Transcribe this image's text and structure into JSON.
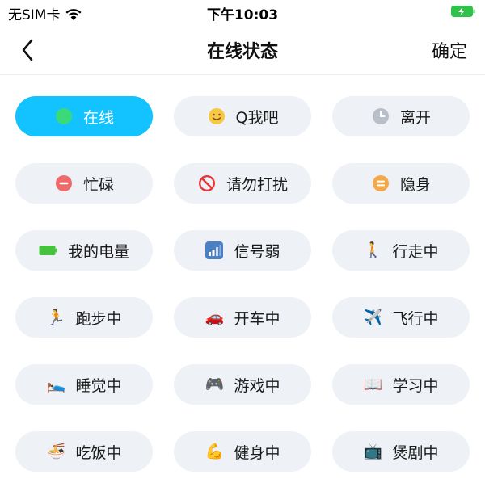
{
  "status_bar": {
    "carrier": "无SIM卡",
    "time": "下午10:03"
  },
  "nav": {
    "title": "在线状态",
    "confirm_label": "确定"
  },
  "colors": {
    "selected_bg": "#12c3ff",
    "chip_bg": "#eef1f6",
    "battery_green": "#2ec24a"
  },
  "statuses": [
    {
      "label": "在线",
      "icon": "green-dot-icon",
      "selected": true
    },
    {
      "label": "Q我吧",
      "icon": "smile-icon",
      "selected": false
    },
    {
      "label": "离开",
      "icon": "clock-icon",
      "selected": false
    },
    {
      "label": "忙碌",
      "icon": "minus-circle-icon",
      "selected": false
    },
    {
      "label": "请勿打扰",
      "icon": "no-entry-icon",
      "selected": false
    },
    {
      "label": "隐身",
      "icon": "equals-circle-icon",
      "selected": false
    },
    {
      "label": "我的电量",
      "icon": "battery-icon",
      "selected": false
    },
    {
      "label": "信号弱",
      "icon": "signal-icon",
      "selected": false
    },
    {
      "label": "行走中",
      "icon": "walking-icon",
      "selected": false
    },
    {
      "label": "跑步中",
      "icon": "running-icon",
      "selected": false
    },
    {
      "label": "开车中",
      "icon": "car-icon",
      "selected": false
    },
    {
      "label": "飞行中",
      "icon": "airplane-icon",
      "selected": false
    },
    {
      "label": "睡觉中",
      "icon": "bed-icon",
      "selected": false
    },
    {
      "label": "游戏中",
      "icon": "gamepad-icon",
      "selected": false
    },
    {
      "label": "学习中",
      "icon": "book-icon",
      "selected": false
    },
    {
      "label": "吃饭中",
      "icon": "noodle-bowl-icon",
      "selected": false
    },
    {
      "label": "健身中",
      "icon": "flexed-bicep-icon",
      "selected": false
    },
    {
      "label": "煲剧中",
      "icon": "tv-icon",
      "selected": false
    }
  ]
}
